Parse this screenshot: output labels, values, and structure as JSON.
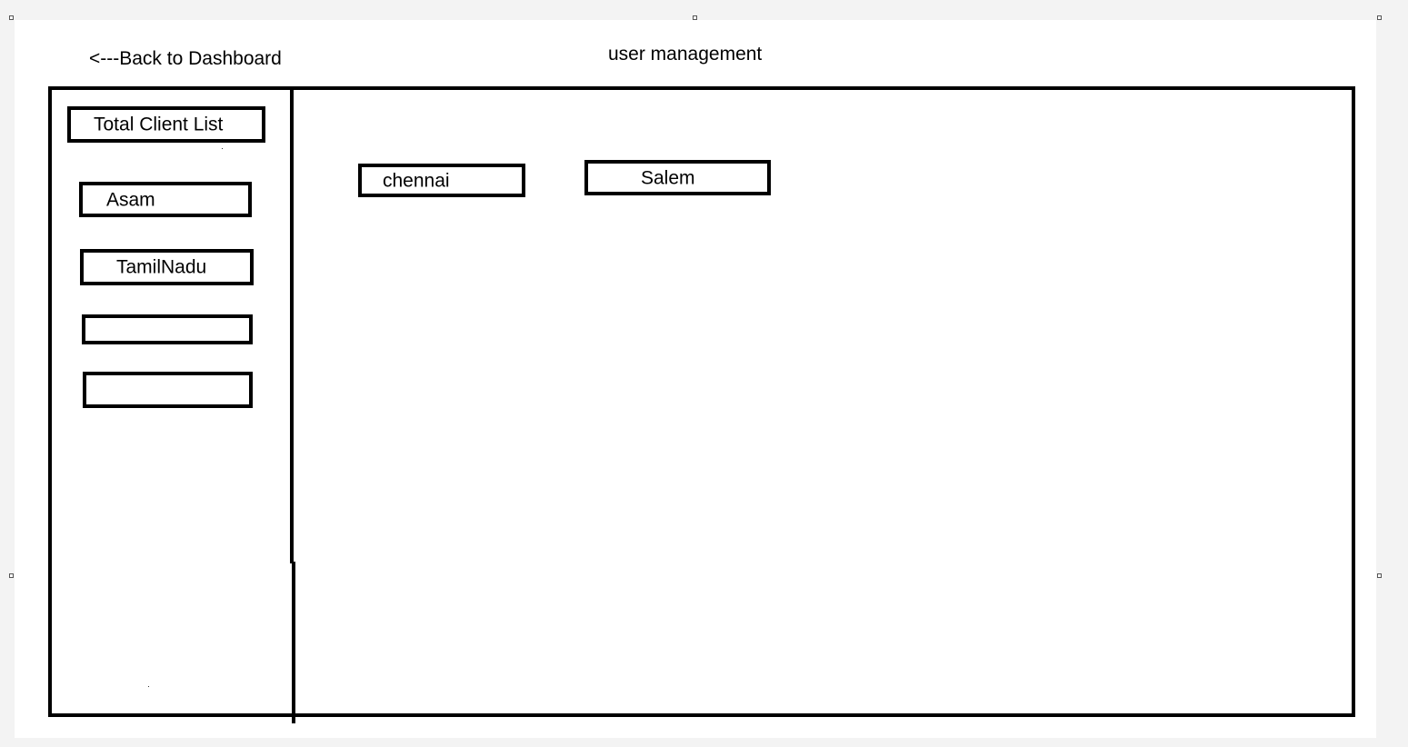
{
  "header": {
    "back_link": "<---Back to Dashboard",
    "title": "user management"
  },
  "sidebar": {
    "heading": "Total Client List",
    "items": [
      {
        "label": "Asam"
      },
      {
        "label": "TamilNadu"
      },
      {
        "label": ""
      },
      {
        "label": ""
      }
    ]
  },
  "main": {
    "cities": [
      {
        "label": "chennai"
      },
      {
        "label": "Salem"
      }
    ]
  },
  "colors": {
    "stroke": "#000000",
    "canvas": "#ffffff",
    "surround": "#f3f3f3"
  }
}
